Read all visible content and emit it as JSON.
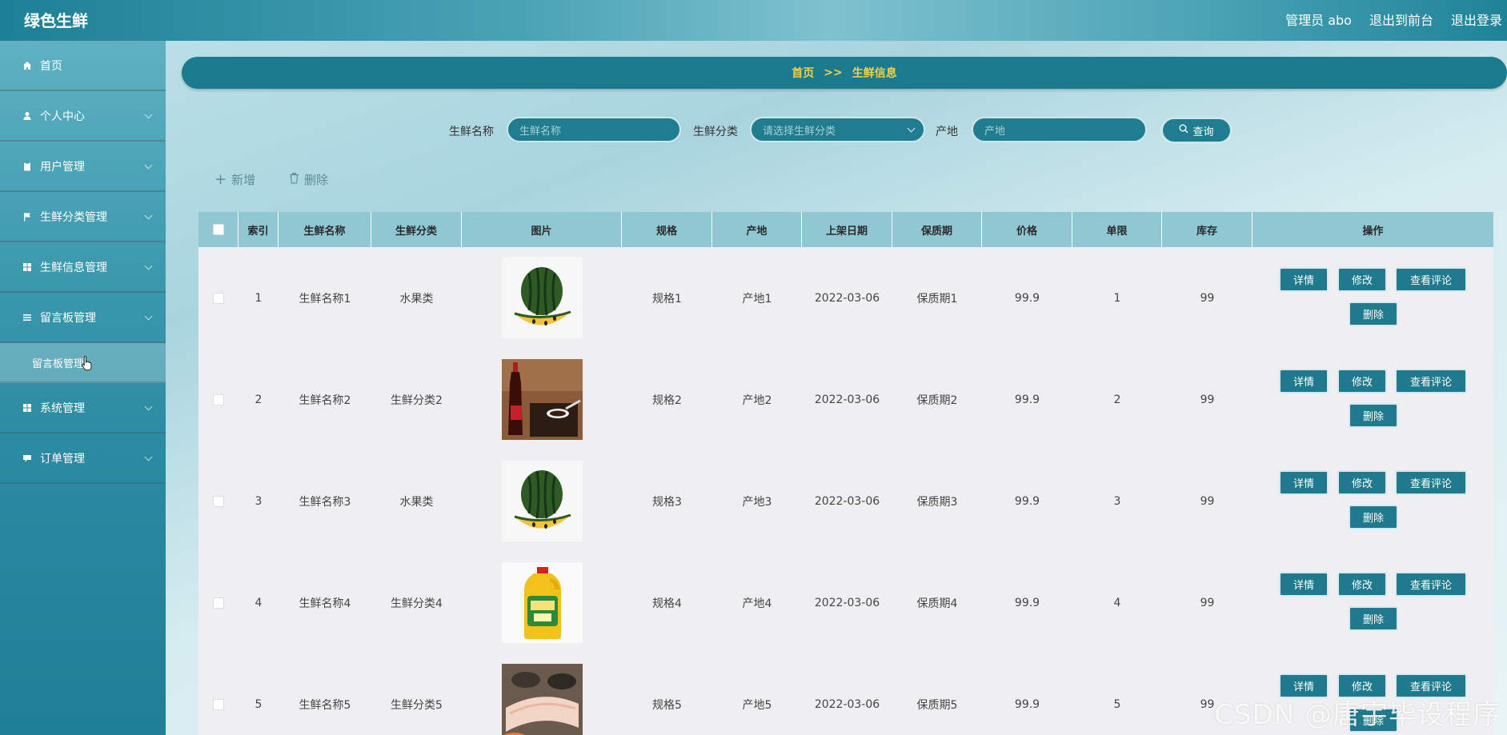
{
  "header": {
    "brand": "绿色生鲜",
    "admin": "管理员 abo",
    "to_front": "退出到前台",
    "logout": "退出登录"
  },
  "sidebar": {
    "items": [
      {
        "label": "首页",
        "icon": "home-icon"
      },
      {
        "label": "个人中心",
        "icon": "user-icon"
      },
      {
        "label": "用户管理",
        "icon": "clipboard-icon"
      },
      {
        "label": "生鲜分类管理",
        "icon": "flag-icon"
      },
      {
        "label": "生鲜信息管理",
        "icon": "grid-icon"
      },
      {
        "label": "留言板管理",
        "icon": "list-icon"
      },
      {
        "label": "系统管理",
        "icon": "grid-icon"
      },
      {
        "label": "订单管理",
        "icon": "chat-icon"
      }
    ],
    "sub_item": "留言板管理"
  },
  "breadcrumb": {
    "home": "首页",
    "sep": ">>",
    "current": "生鲜信息"
  },
  "search": {
    "name_label": "生鲜名称",
    "name_placeholder": "生鲜名称",
    "category_label": "生鲜分类",
    "category_placeholder": "请选择生鲜分类",
    "origin_label": "产地",
    "origin_placeholder": "产地",
    "query_button": "查询"
  },
  "toolbar": {
    "add": "新增",
    "delete": "删除"
  },
  "table": {
    "headers": [
      "索引",
      "生鲜名称",
      "生鲜分类",
      "图片",
      "规格",
      "产地",
      "上架日期",
      "保质期",
      "价格",
      "单限",
      "库存",
      "操作"
    ],
    "rows": [
      {
        "index": "1",
        "name": "生鲜名称1",
        "category": "水果类",
        "image": "watermelon",
        "spec": "规格1",
        "origin": "产地1",
        "date": "2022-03-06",
        "shelf": "保质期1",
        "price": "99.9",
        "limit": "1",
        "stock": "99"
      },
      {
        "index": "2",
        "name": "生鲜名称2",
        "category": "生鲜分类2",
        "image": "sauce",
        "spec": "规格2",
        "origin": "产地2",
        "date": "2022-03-06",
        "shelf": "保质期2",
        "price": "99.9",
        "limit": "2",
        "stock": "99"
      },
      {
        "index": "3",
        "name": "生鲜名称3",
        "category": "水果类",
        "image": "watermelon",
        "spec": "规格3",
        "origin": "产地3",
        "date": "2022-03-06",
        "shelf": "保质期3",
        "price": "99.9",
        "limit": "3",
        "stock": "99"
      },
      {
        "index": "4",
        "name": "生鲜名称4",
        "category": "生鲜分类4",
        "image": "oil",
        "spec": "规格4",
        "origin": "产地4",
        "date": "2022-03-06",
        "shelf": "保质期4",
        "price": "99.9",
        "limit": "4",
        "stock": "99"
      },
      {
        "index": "5",
        "name": "生鲜名称5",
        "category": "生鲜分类5",
        "image": "seafood",
        "spec": "规格5",
        "origin": "产地5",
        "date": "2022-03-06",
        "shelf": "保质期5",
        "price": "99.9",
        "limit": "5",
        "stock": "99"
      }
    ],
    "actions": {
      "detail": "详情",
      "edit": "修改",
      "comments": "查看评论",
      "delete": "删除"
    }
  },
  "watermark": "CSDN @唐宇毕设程序"
}
